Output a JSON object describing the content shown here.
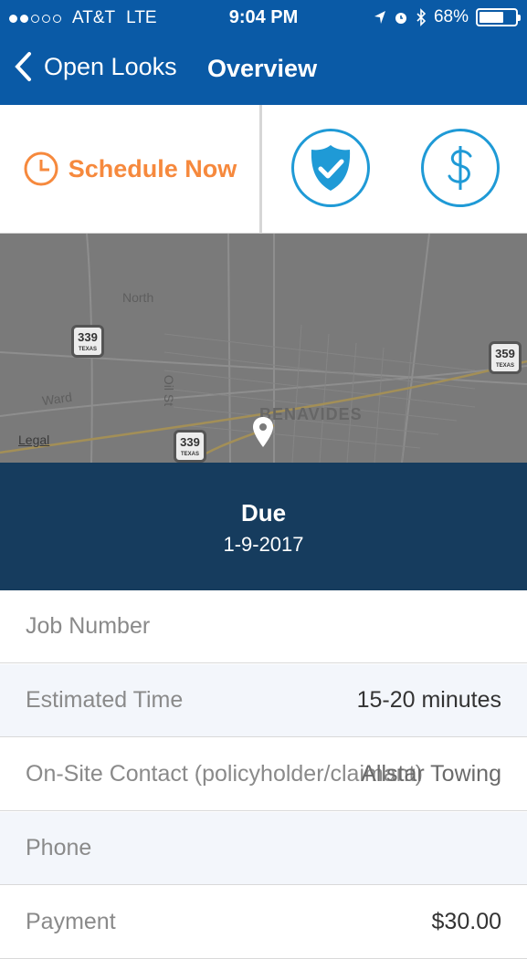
{
  "status_bar": {
    "carrier": "AT&T",
    "network": "LTE",
    "time": "9:04 PM",
    "battery": "68%",
    "battery_level": 0.68
  },
  "nav": {
    "back_label": "Open Looks",
    "title": "Overview"
  },
  "actions": {
    "schedule_label": "Schedule Now",
    "accent_orange": "#f6893d",
    "accent_blue": "#1f9ad6"
  },
  "map": {
    "labels": {
      "north": "North",
      "ward": "Ward",
      "oil": "Oil St",
      "town": "BENAVIDES",
      "legal": "Legal"
    },
    "shields": {
      "a": "339",
      "b": "359",
      "c": "339",
      "state": "TEXAS"
    }
  },
  "due": {
    "heading": "Due",
    "date": "1-9-2017"
  },
  "details": {
    "job_number_label": "Job Number",
    "estimated_time_label": "Estimated Time",
    "estimated_time_value": "15-20 minutes",
    "contact_label": "On-Site Contact (policyholder/claimant)",
    "contact_value": "Allstar Towing",
    "phone_label": "Phone",
    "payment_label": "Payment",
    "payment_value": "$30.00"
  }
}
